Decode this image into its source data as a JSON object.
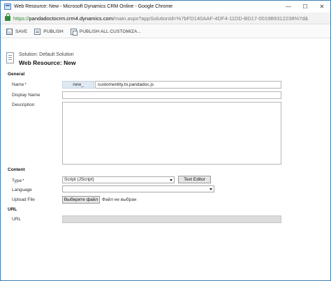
{
  "window": {
    "title": "Web Resource: New - Microsoft Dynamics CRM Online - Google Chrome",
    "minimize_symbol": "—",
    "maximize_symbol": "☐",
    "close_symbol": "✕"
  },
  "address": {
    "protocol": "https://",
    "host": "pandadoctocrm.crm4.dynamics.com",
    "path": "/main.aspx?appSolutionId=%7bFD140AAF-4DF4-11DD-BD17-0019B9312238%7d&"
  },
  "toolbar": {
    "save_label": "SAVE",
    "publish_label": "PUBLISH",
    "publish_all_label": "PUBLISH ALL CUSTOMIZA..."
  },
  "header": {
    "solution": "Solution: Default Solution",
    "title": "Web Resource: New"
  },
  "general": {
    "section_title": "General",
    "name_label": "Name",
    "name_prefix": "new_",
    "name_value": "customentity.to.pandadoc.js",
    "display_name_label": "Display Name",
    "display_name_value": "",
    "description_label": "Description",
    "description_value": ""
  },
  "content": {
    "section_title": "Content",
    "type_label": "Type",
    "type_value": "Script (JScript)",
    "text_editor_label": "Text Editor",
    "language_label": "Language",
    "language_value": "",
    "upload_label": "Upload File",
    "choose_file_label": "Выберите файл",
    "file_status": "Файл не выбран"
  },
  "url_section": {
    "section_title": "URL",
    "url_label": "URL",
    "url_value": ""
  },
  "icons": {
    "app": "crm-page-icon",
    "lock": "secure-lock-icon",
    "save": "save-icon",
    "publish": "publish-icon",
    "publish_all": "publish-all-icon",
    "form": "web-resource-form-icon"
  }
}
